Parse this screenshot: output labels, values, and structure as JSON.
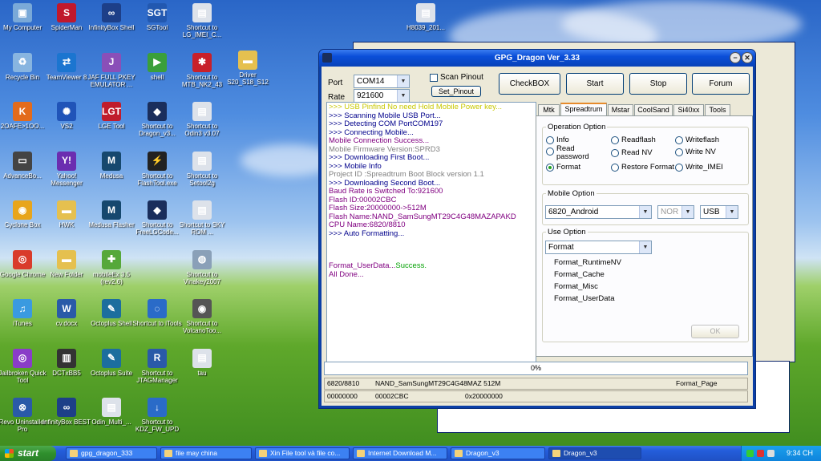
{
  "desktop_icons": [
    {
      "label": "My Computer",
      "color": "#7aa9d8",
      "glyph": "▣"
    },
    {
      "label": "SpiderMan",
      "color": "#c0182c",
      "glyph": "S"
    },
    {
      "label": "InfinityBox Shell",
      "color": "#1d3f88",
      "glyph": "∞"
    },
    {
      "label": "SGTool",
      "color": "#2258b0",
      "glyph": "SGT"
    },
    {
      "label": "Shortcut to LG_IMEI_C...",
      "color": "#dde2ea",
      "glyph": "▤"
    },
    {
      "label": "Recycle Bin",
      "color": "#88b5e0",
      "glyph": "♻"
    },
    {
      "label": "TeamViewer 8",
      "color": "#1b75d0",
      "glyph": "⇄"
    },
    {
      "label": "JAF FULL PKEY EMULATOR ...",
      "color": "#8a4fb8",
      "glyph": "J"
    },
    {
      "label": "shell",
      "color": "#3a9f3a",
      "glyph": "▶"
    },
    {
      "label": "Shortcut to MTB_NK2_43",
      "color": "#c8202a",
      "glyph": "✱"
    },
    {
      "label": "Driver S20_S18_S12",
      "color": "#e5c04f",
      "glyph": "▬"
    },
    {
      "label": "2OAFE>1OO...",
      "color": "#e36b1c",
      "glyph": "K"
    },
    {
      "label": "VS2",
      "color": "#2054b8",
      "glyph": "✺"
    },
    {
      "label": "LGE Tool",
      "color": "#c01c2c",
      "glyph": "LGT"
    },
    {
      "label": "Shortcut to Dragon_v3...",
      "color": "#1a2e5c",
      "glyph": "◆"
    },
    {
      "label": "Shortcut to Odin3 v3.07",
      "color": "#dde2ea",
      "glyph": "▤"
    },
    {
      "label": "AdvanceBo...",
      "color": "#444",
      "glyph": "▭"
    },
    {
      "label": "Yahoo! Messenger",
      "color": "#6b2db0",
      "glyph": "Y!"
    },
    {
      "label": "Medusa",
      "color": "#16486e",
      "glyph": "M"
    },
    {
      "label": "Shortcut to FlashTool.exe",
      "color": "#222",
      "glyph": "⚡"
    },
    {
      "label": "Shortcut to Setool2g",
      "color": "#dde2ea",
      "glyph": "▤"
    },
    {
      "label": "Cyclone Box",
      "color": "#e8a51c",
      "glyph": "◉"
    },
    {
      "label": "HWK",
      "color": "#e5c04f",
      "glyph": "▬"
    },
    {
      "label": "Medusa Flasher",
      "color": "#16486e",
      "glyph": "M"
    },
    {
      "label": "Shortcut to FreeLGCode...",
      "color": "#1a2e5c",
      "glyph": "◆"
    },
    {
      "label": "Shortcut to SKY ROM ...",
      "color": "#dde2ea",
      "glyph": "▤"
    },
    {
      "label": "Google Chrome",
      "color": "#d93b2b",
      "glyph": "◎"
    },
    {
      "label": "New Folder",
      "color": "#e5c04f",
      "glyph": "▬"
    },
    {
      "label": "mobileEx 3.5 (rev2.6)",
      "color": "#56a83a",
      "glyph": "✚"
    },
    {
      "label": "Shortcut to Vinakey2007",
      "color": "#8aa0b8",
      "glyph": "◍"
    },
    {
      "label": "iTunes",
      "color": "#3a9ae0",
      "glyph": "♫"
    },
    {
      "label": "cv.docx",
      "color": "#2a5aa8",
      "glyph": "W"
    },
    {
      "label": "Octoplus Shell",
      "color": "#1c6e9e",
      "glyph": "✎"
    },
    {
      "label": "Shortcut to iTools",
      "color": "#2a6bc8",
      "glyph": "◌"
    },
    {
      "label": "Shortcut to VolcanoToo...",
      "color": "#555",
      "glyph": "◉"
    },
    {
      "label": "Jailbroken Quick Tool",
      "color": "#8a3cc8",
      "glyph": "◎"
    },
    {
      "label": "DCTxBB5",
      "color": "#333",
      "glyph": "▥"
    },
    {
      "label": "Octoplus Suite",
      "color": "#1c6e9e",
      "glyph": "✎"
    },
    {
      "label": "Shortcut to JTAGManager",
      "color": "#2a5aa8",
      "glyph": "R"
    },
    {
      "label": "tau",
      "color": "#dde2ea",
      "glyph": "▤"
    },
    {
      "label": "Revo Uninstaller Pro",
      "color": "#2a5aa8",
      "glyph": "⊗"
    },
    {
      "label": "InfinityBox BEST",
      "color": "#1d3f88",
      "glyph": "∞"
    },
    {
      "label": "Odin_Multi_...",
      "color": "#dde2ea",
      "glyph": "▤"
    },
    {
      "label": "Shortcut to KDZ_FW_UPD",
      "color": "#2a6bc8",
      "glyph": "↓"
    },
    {
      "label": "H8039_201...",
      "color": "#dde2ea",
      "glyph": "▤"
    }
  ],
  "window": {
    "title": "GPG_Dragon  Ver_3.33",
    "port_label": "Port",
    "port_value": "COM14",
    "rate_label": "Rate",
    "rate_value": "921600",
    "scan_pinout_label": "Scan Pinout",
    "set_pinout_label": "Set_Pinout",
    "buttons": [
      "CheckBOX",
      "Start",
      "Stop",
      "Forum"
    ],
    "log": [
      {
        "text": ">>> USB Pinfind No need Hold Mobile Power key...",
        "color": "#c8c800"
      },
      {
        "text": ">>> Scanning Mobile USB Port...",
        "color": "#00008b"
      },
      {
        "text": ">>> Detecting COM PortCOM197",
        "color": "#00008b"
      },
      {
        "text": ">>> Connecting Mobile...",
        "color": "#00008b"
      },
      {
        "text": "   Mobile Connection Success...",
        "color": "#800080"
      },
      {
        "text": "   Mobile Firmware Version:SPRD3",
        "color": "#808080"
      },
      {
        "text": ">>> Downloading First Boot...",
        "color": "#00008b"
      },
      {
        "text": ">>> Mobile Info",
        "color": "#00008b"
      },
      {
        "text": "   Project ID :Spreadtrum Boot Block version 1.1",
        "color": "#808080"
      },
      {
        "text": ">>> Downloading Second Boot...",
        "color": "#00008b"
      },
      {
        "text": "    Baud Rate is Switched To:921600",
        "color": "#800080"
      },
      {
        "text": "   Flash ID:00002CBC",
        "color": "#800080"
      },
      {
        "text": "   Flash Size:20000000->512M",
        "color": "#800080"
      },
      {
        "text": "   Flash Name:NAND_SamSungMT29C4G48MAZAPAKD",
        "color": "#800080"
      },
      {
        "text": "   CPU Name:6820/8810",
        "color": "#800080"
      },
      {
        "text": ">>> Auto Formatting...",
        "color": "#00008b"
      }
    ],
    "log_tail_a": "   Format_UserData...",
    "log_tail_b": "Success.",
    "log_done": "   All Done...",
    "tabs": [
      "Mtk",
      "Spreadtrum",
      "Mstar",
      "CoolSand",
      "Si40xx",
      "Tools"
    ],
    "active_tab": "Spreadtrum",
    "operation_option": {
      "title": "Operation Option",
      "options": [
        "Info",
        "Readflash",
        "Writeflash",
        "Read password",
        "Read NV",
        "Write NV",
        "Format",
        "Restore Format",
        "Write_IMEI"
      ],
      "selected": "Format"
    },
    "mobile_option": {
      "title": "Mobile Option",
      "model": "6820_Android",
      "nor": "NOR",
      "usb": "USB"
    },
    "use_option": {
      "title": "Use Option",
      "selected": "Format",
      "items": [
        "Format_RuntimeNV",
        "Format_Cache",
        "Format_Misc",
        "Format_UserData"
      ],
      "ok_label": "OK"
    },
    "progress": "0%",
    "status_row1": [
      "6820/8810",
      "NAND_SamSungMT29C4G48MAZ 512M",
      "Format_Page"
    ],
    "status_row2": [
      "00000000",
      "00002CBC",
      "0x20000000"
    ]
  },
  "taskbar": {
    "start_label": "start",
    "items": [
      "gpg_dragon_333",
      "file may china",
      "Xin File tool và file co...",
      "Internet Download M...",
      "Dragon_v3",
      "Dragon_v3"
    ],
    "clock": "9:34 CH"
  }
}
